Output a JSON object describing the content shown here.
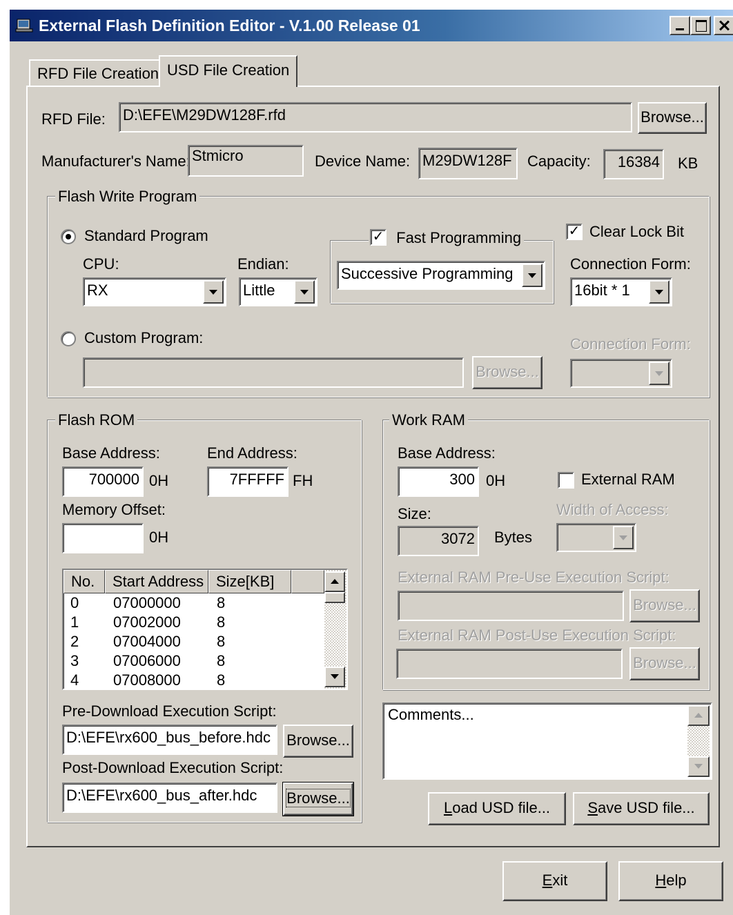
{
  "window": {
    "title": "External Flash Definition Editor - V.1.00 Release 01"
  },
  "tabs": [
    {
      "label": "RFD File Creation"
    },
    {
      "label": "USD File Creation"
    }
  ],
  "rfd": {
    "label": "RFD File:",
    "value": "D:\\EFE\\M29DW128F.rfd",
    "browse": "Browse..."
  },
  "device": {
    "manufacturer_label": "Manufacturer's Name:",
    "manufacturer_value": "Stmicro",
    "device_label": "Device Name:",
    "device_value": "M29DW128F",
    "capacity_label": "Capacity:",
    "capacity_value": "16384",
    "capacity_unit": "KB"
  },
  "flash_write": {
    "title": "Flash Write Program",
    "standard_label": "Standard Program",
    "cpu_label": "CPU:",
    "cpu_value": "RX",
    "endian_label": "Endian:",
    "endian_value": "Little",
    "fast_label": "Fast Programming",
    "fast_checked": true,
    "fast_mode_value": "Successive Programming",
    "clear_lock_label": "Clear Lock Bit",
    "clear_lock_checked": true,
    "conn_label": "Connection Form:",
    "conn_value": "16bit * 1",
    "custom_label": "Custom Program:",
    "custom_value": "",
    "custom_browse": "Browse...",
    "custom_conn_label": "Connection Form:"
  },
  "flash_rom": {
    "title": "Flash ROM",
    "base_label": "Base Address:",
    "base_value": "700000",
    "base_suffix": "0H",
    "end_label": "End Address:",
    "end_value": "7FFFFF",
    "end_suffix": "FH",
    "offset_label": "Memory Offset:",
    "offset_value": "",
    "offset_suffix": "0H",
    "columns": [
      "No.",
      "Start Address",
      "Size[KB]"
    ],
    "rows": [
      {
        "no": "0",
        "start": "07000000",
        "size": "8"
      },
      {
        "no": "1",
        "start": "07002000",
        "size": "8"
      },
      {
        "no": "2",
        "start": "07004000",
        "size": "8"
      },
      {
        "no": "3",
        "start": "07006000",
        "size": "8"
      },
      {
        "no": "4",
        "start": "07008000",
        "size": "8"
      }
    ],
    "pre_label": "Pre-Download Execution Script:",
    "pre_value": "D:\\EFE\\rx600_bus_before.hdc",
    "post_label": "Post-Download Execution Script:",
    "post_value": "D:\\EFE\\rx600_bus_after.hdc",
    "browse": "Browse..."
  },
  "work_ram": {
    "title": "Work RAM",
    "base_label": "Base Address:",
    "base_value": "300",
    "base_suffix": "0H",
    "external_label": "External RAM",
    "external_checked": false,
    "size_label": "Size:",
    "size_value": "3072",
    "size_unit": "Bytes",
    "width_label": "Width of Access:",
    "pre_label": "External RAM Pre-Use Execution Script:",
    "post_label": "External RAM Post-Use Execution Script:",
    "browse": "Browse..."
  },
  "comments": {
    "text": "Comments..."
  },
  "buttons": {
    "load_pre": "",
    "load_key": "L",
    "load_post": "oad USD file...",
    "save_key": "S",
    "save_post": "ave USD file...",
    "exit_key": "E",
    "exit_post": "xit",
    "help_key": "H",
    "help_post": "elp"
  }
}
